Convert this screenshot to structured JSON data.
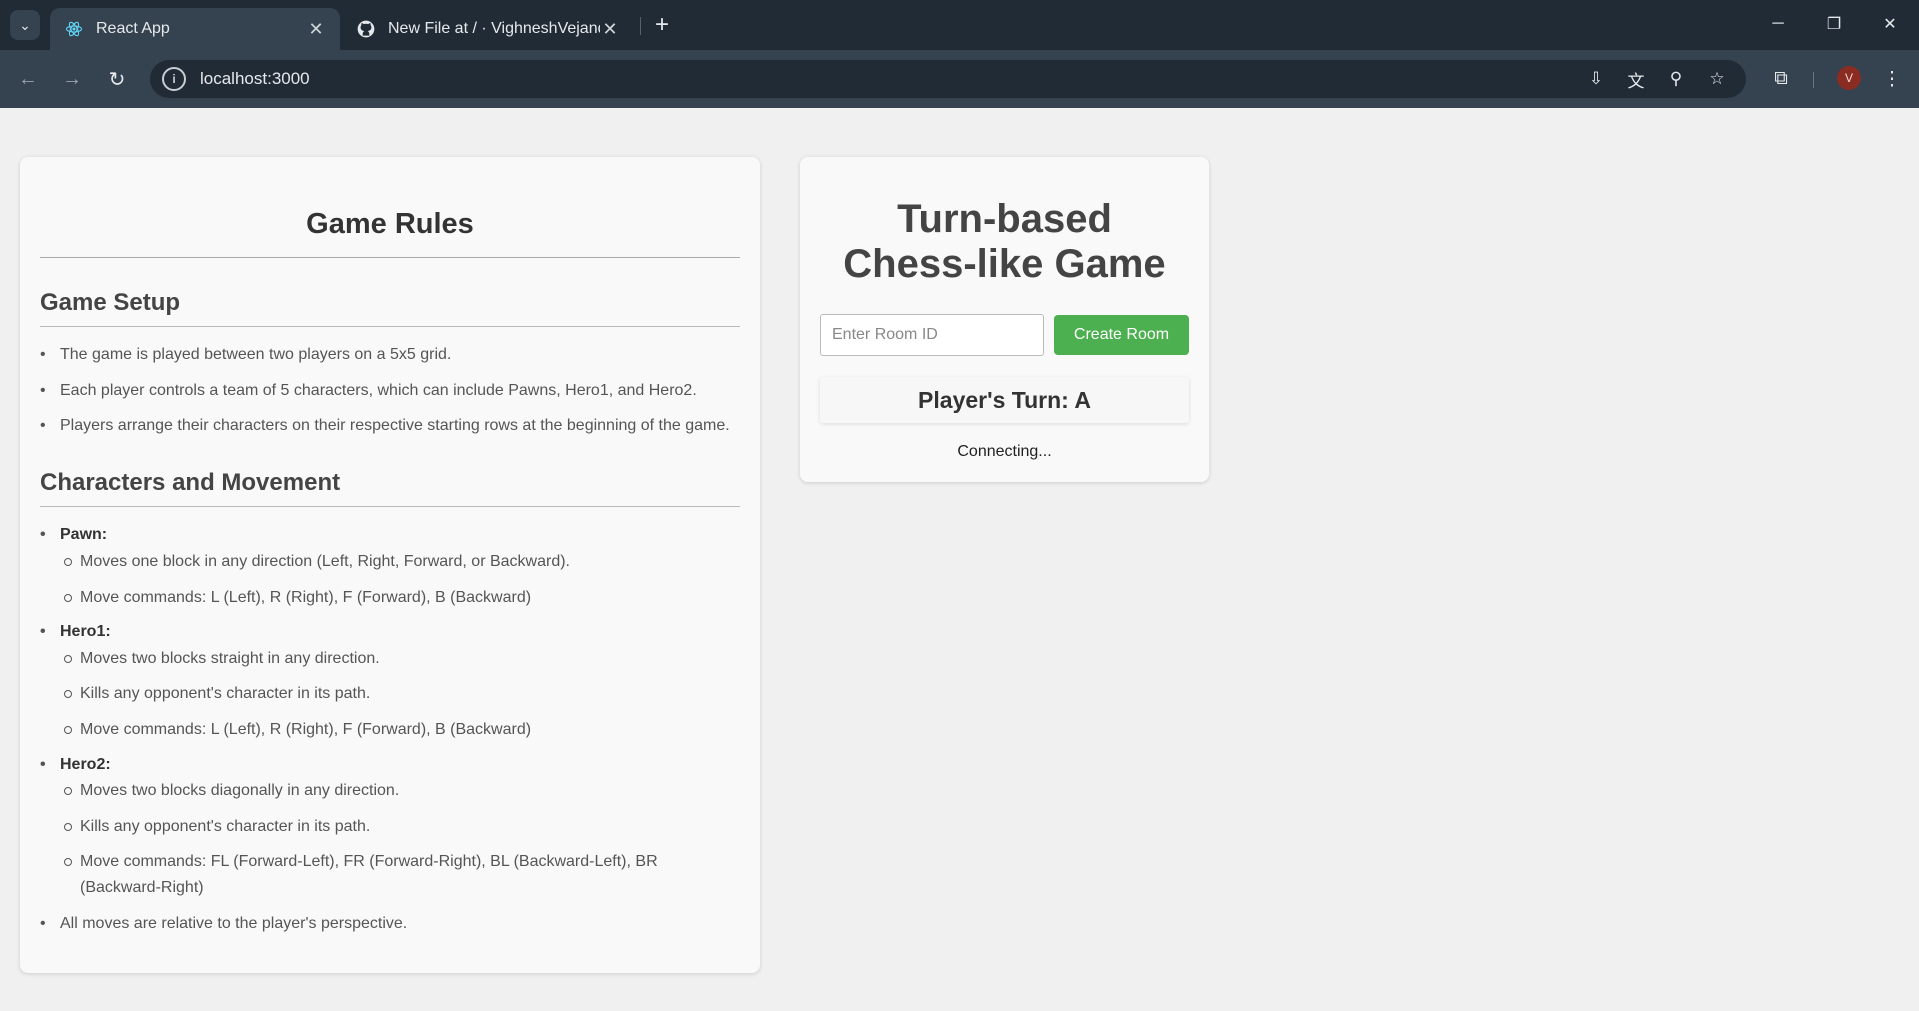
{
  "browser": {
    "tabs": [
      {
        "title": "React App",
        "active": true
      },
      {
        "title": "New File at / · VighneshVejandla",
        "active": false
      }
    ],
    "url": "localhost:3000",
    "profile_initial": "V"
  },
  "rules": {
    "title": "Game Rules",
    "setup": {
      "heading": "Game Setup",
      "items": [
        "The game is played between two players on a 5x5 grid.",
        "Each player controls a team of 5 characters, which can include Pawns, Hero1, and Hero2.",
        "Players arrange their characters on their respective starting rows at the beginning of the game."
      ]
    },
    "characters": {
      "heading": "Characters and Movement",
      "pawn": {
        "name": "Pawn:",
        "items": [
          "Moves one block in any direction (Left, Right, Forward, or Backward).",
          "Move commands: L (Left), R (Right), F (Forward), B (Backward)"
        ]
      },
      "hero1": {
        "name": "Hero1:",
        "items": [
          "Moves two blocks straight in any direction.",
          "Kills any opponent's character in its path.",
          "Move commands: L (Left), R (Right), F (Forward), B (Backward)"
        ]
      },
      "hero2": {
        "name": "Hero2:",
        "items": [
          "Moves two blocks diagonally in any direction.",
          "Kills any opponent's character in its path.",
          "Move commands: FL (Forward-Left), FR (Forward-Right), BL (Backward-Left), BR (Backward-Right)"
        ]
      },
      "footer": "All moves are relative to the player's perspective."
    }
  },
  "game": {
    "title_line1": "Turn-based",
    "title_line2": "Chess-like Game",
    "room_placeholder": "Enter Room ID",
    "room_value": "",
    "create_button": "Create Room",
    "turn_text": "Player's Turn: A",
    "status": "Connecting..."
  },
  "colors": {
    "create_button": "#4caf50",
    "browser_dark": "#202b36"
  }
}
